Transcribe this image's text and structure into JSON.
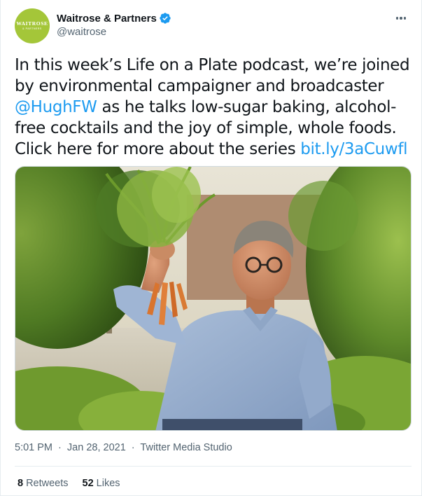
{
  "account": {
    "avatar_word": "WAITROSE",
    "avatar_sub": "& PARTNERS",
    "display_name": "Waitrose & Partners",
    "handle": "@waitrose"
  },
  "tweet": {
    "text_1": "In this week’s Life on a Plate podcast, we’re joined by environmental campaigner and broadcaster ",
    "mention": "@HughFW",
    "text_2": " as he talks low-sugar baking, alcohol-free cocktails and the joy of simple, whole foods. Click here for more about the series ",
    "url": "bit.ly/3aCuwfl"
  },
  "meta": {
    "time": "5:01 PM",
    "separator": "·",
    "date": "Jan 28, 2021",
    "source": "Twitter Media Studio"
  },
  "stats": {
    "retweets_count": "8",
    "retweets_label": "Retweets",
    "likes_count": "52",
    "likes_label": "Likes"
  },
  "colors": {
    "brand_green": "#a4c639",
    "link_blue": "#1d9bf0",
    "verified_blue": "#1d9bf0",
    "muted_text": "#536471"
  },
  "icons": {
    "verified": "verified-badge-icon",
    "more": "more-options-icon"
  }
}
